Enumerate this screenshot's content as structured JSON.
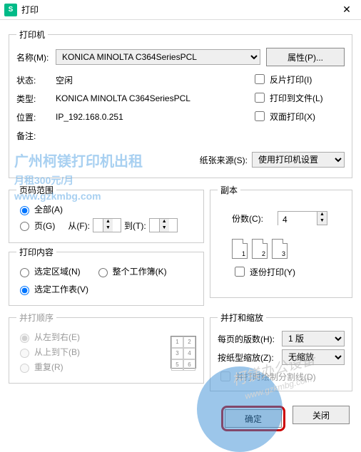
{
  "title": "打印",
  "printer": {
    "legend": "打印机",
    "name_lbl": "名称(M):",
    "name_val": "KONICA MINOLTA C364SeriesPCL",
    "prop_btn": "属性(P)...",
    "status_lbl": "状态:",
    "status_val": "空闲",
    "type_lbl": "类型:",
    "type_val": "KONICA MINOLTA C364SeriesPCL",
    "where_lbl": "位置:",
    "where_val": "IP_192.168.0.251",
    "comment_lbl": "备注:",
    "reverse": "反片打印(I)",
    "tofile": "打印到文件(L)",
    "duplex": "双面打印(X)",
    "source_lbl": "纸张来源(S):",
    "source_val": "使用打印机设置"
  },
  "range": {
    "legend": "页码范围",
    "all": "全部(A)",
    "pages": "页(G)",
    "from": "从(F):",
    "to": "到(T):"
  },
  "copies": {
    "legend": "副本",
    "count_lbl": "份数(C):",
    "count_val": "4",
    "collate": "逐份打印(Y)"
  },
  "what": {
    "legend": "打印内容",
    "selection": "选定区域(N)",
    "workbook": "整个工作簿(K)",
    "sheet": "选定工作表(V)"
  },
  "order": {
    "legend": "并打顺序",
    "lr": "从左到右(E)",
    "tb": "从上到下(B)",
    "repeat": "重复(R)"
  },
  "scale": {
    "legend": "并打和缩放",
    "perpage_lbl": "每页的版数(H):",
    "perpage_val": "1 版",
    "fit_lbl": "按纸型缩放(Z):",
    "fit_val": "无缩放",
    "drawline": "并打时绘制分割线(D)"
  },
  "footer": {
    "ok": "确定",
    "cancel": "关闭"
  },
  "wm": {
    "line1": "广州柯镁打印机出租",
    "line2": "月租300元/月",
    "line3": "www.gzkmbg.com",
    "brand": "柯镁办公设备"
  }
}
